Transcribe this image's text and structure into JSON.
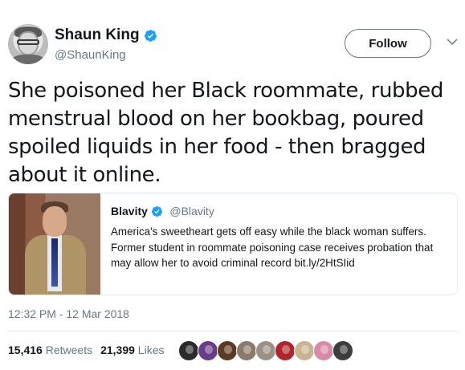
{
  "tweet": {
    "author": {
      "name": "Shaun King",
      "handle": "@ShaunKing"
    },
    "follow_label": "Follow",
    "text": "She poisoned her Black roommate, rubbed menstrual blood on her bookbag, poured spoiled liquids in her food - then bragged about it online.",
    "quoted": {
      "name": "Blavity",
      "handle": "@Blavity",
      "text": "America's sweetheart gets off easy while the black woman suffers. Former student in roommate poisoning case receives probation that may allow her to avoid criminal record bit.ly/2HtSIid"
    },
    "timestamp": "12:32 PM - 12 Mar 2018",
    "retweets": {
      "count": "15,416",
      "label": "Retweets"
    },
    "likes": {
      "count": "21,399",
      "label": "Likes"
    }
  },
  "colors": {
    "verified": "#1da1f2",
    "secondary_text": "#657786",
    "primary_text": "#14171a",
    "border": "#e1e8ed"
  },
  "liker_avatars": [
    {
      "icon": "liker-avatar-icon",
      "color": "#2b2b2b"
    },
    {
      "icon": "liker-avatar-icon",
      "color": "#6a3d8a"
    },
    {
      "icon": "liker-avatar-icon",
      "color": "#5a3a22"
    },
    {
      "icon": "liker-avatar-icon",
      "color": "#8a7a6a"
    },
    {
      "icon": "liker-avatar-icon",
      "color": "#9c8f86"
    },
    {
      "icon": "liker-avatar-icon",
      "color": "#b0252b"
    },
    {
      "icon": "liker-avatar-icon",
      "color": "#c9b48f"
    },
    {
      "icon": "liker-avatar-icon",
      "color": "#d98aa6"
    },
    {
      "icon": "liker-avatar-icon",
      "color": "#3d3d3d"
    }
  ]
}
